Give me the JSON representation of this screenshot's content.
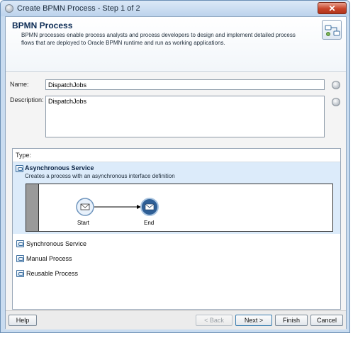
{
  "window": {
    "title": "Create BPMN Process - Step 1 of 2",
    "close_label": "✕"
  },
  "header": {
    "title": "BPMN Process",
    "description": "BPMN processes enable process analysts and process developers to design and implement detailed process flows that are deployed to Oracle BPMN runtime and run as working applications."
  },
  "form": {
    "name_label": "Name:",
    "name_value": "DispatchJobs",
    "description_label": "Description:",
    "description_value": "DispatchJobs"
  },
  "type": {
    "label": "Type:",
    "selected": {
      "title": "Asynchronous Service",
      "description": "Creates a process with an asynchronous interface definition",
      "diagram": {
        "start_label": "Start",
        "end_label": "End"
      }
    },
    "items": [
      {
        "label": "Synchronous Service"
      },
      {
        "label": "Manual Process"
      },
      {
        "label": "Reusable Process"
      }
    ]
  },
  "buttons": {
    "help": "Help",
    "back": "< Back",
    "next": "Next >",
    "finish": "Finish",
    "cancel": "Cancel"
  },
  "colors": {
    "accent": "#3d6f9f",
    "selected_bg": "#dcebfa",
    "header_title": "#0d2c55"
  }
}
